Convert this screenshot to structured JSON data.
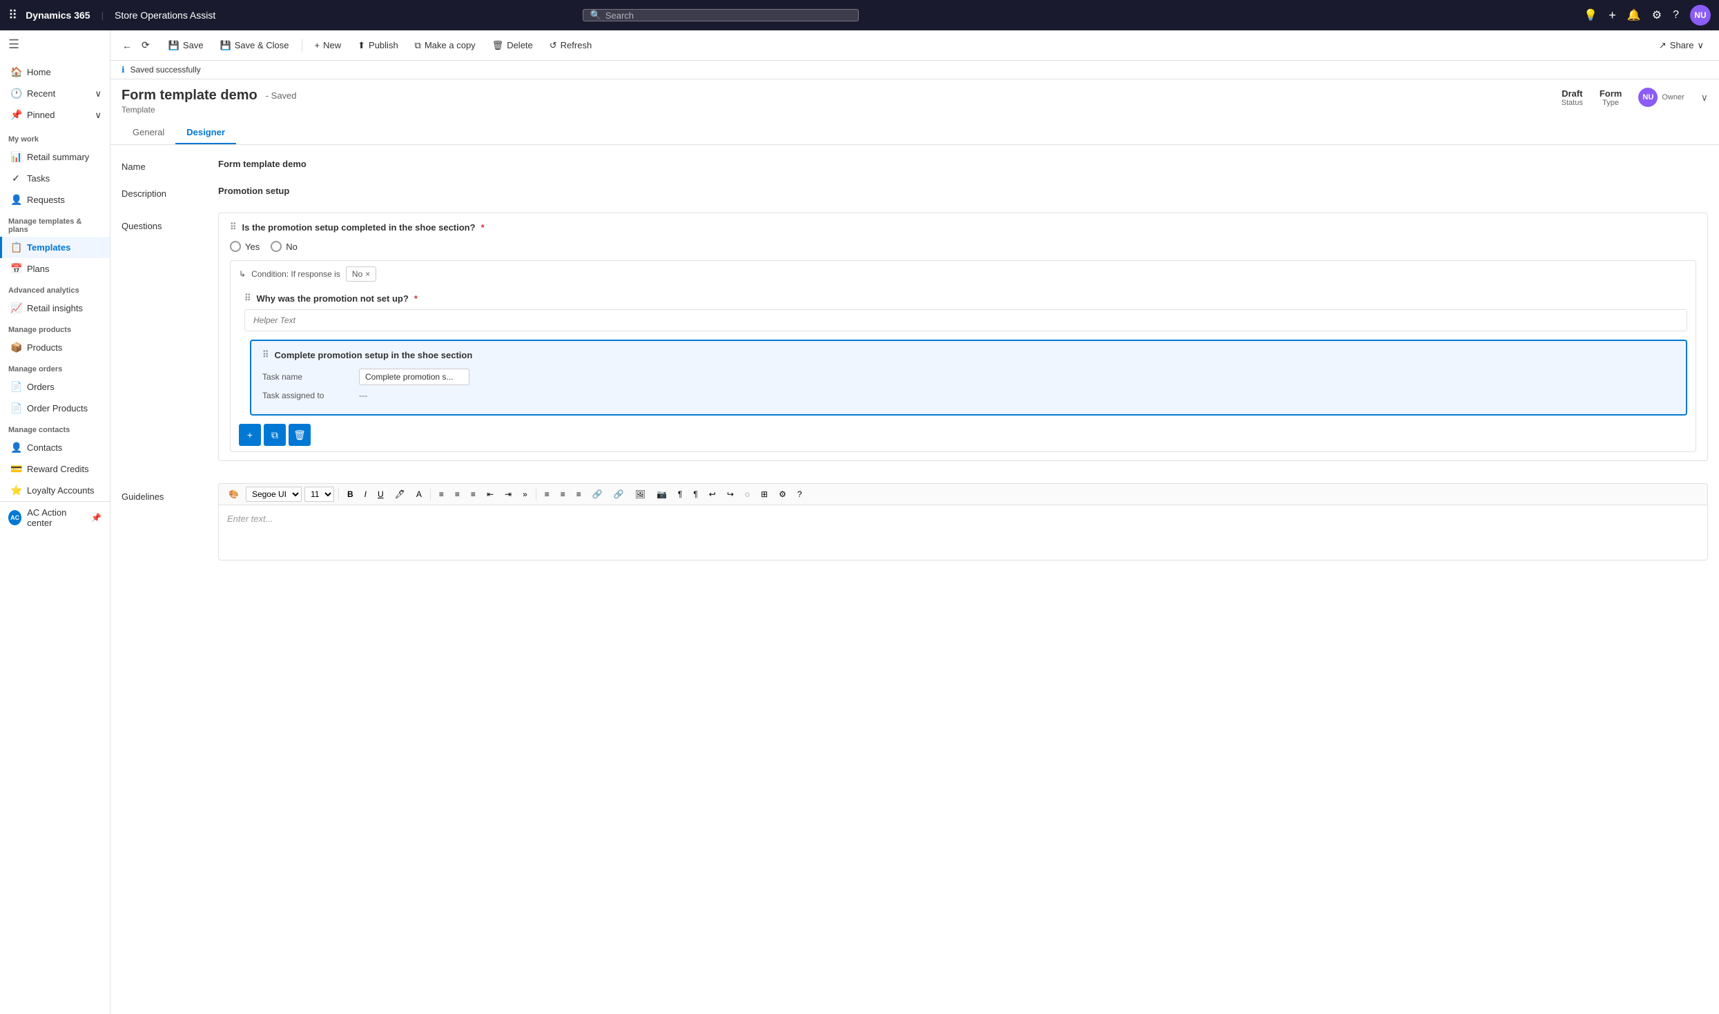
{
  "topNav": {
    "dotsIcon": "⠿",
    "logo": "Dynamics 365",
    "separator": "|",
    "appName": "Store Operations Assist",
    "searchPlaceholder": "Search",
    "icons": {
      "lightbulb": "💡",
      "plus": "+",
      "bell": "🔔",
      "gear": "⚙",
      "help": "?"
    },
    "avatar": "NU"
  },
  "toolbar": {
    "backLabel": "←",
    "forwardLabel": "⟳",
    "save": "Save",
    "saveClose": "Save & Close",
    "new": "New",
    "publish": "Publish",
    "makeCopy": "Make a copy",
    "delete": "Delete",
    "refresh": "Refresh",
    "share": "Share"
  },
  "savedNotice": {
    "icon": "ℹ",
    "text": "Saved successfully"
  },
  "formHeader": {
    "title": "Form template demo",
    "savedLabel": "- Saved",
    "subtitle": "Template",
    "statusLabel": "Status",
    "statusValue": "Draft",
    "typeLabel": "Type",
    "typeValue": "Form",
    "ownerLabel": "Owner",
    "ownerAvatar": "NU",
    "tabs": [
      "General",
      "Designer"
    ]
  },
  "formFields": {
    "nameLabel": "Name",
    "nameValue": "Form template demo",
    "descriptionLabel": "Description",
    "descriptionValue": "Promotion setup",
    "questionsLabel": "Questions"
  },
  "question1": {
    "text": "Is the promotion setup completed in the shoe section?",
    "required": "*",
    "options": [
      "Yes",
      "No"
    ],
    "conditionLabel": "Condition: If response is",
    "conditionValue": "No"
  },
  "question2": {
    "text": "Why was the promotion not set up?",
    "required": "*",
    "helperPlaceholder": "Helper Text"
  },
  "taskCard": {
    "title": "Complete promotion setup in the shoe section",
    "taskNameLabel": "Task name",
    "taskNameValue": "Complete promotion s...",
    "taskAssignedLabel": "Task assigned to",
    "taskAssignedValue": "---"
  },
  "actionButtons": {
    "add": "+",
    "copy": "⧉",
    "delete": "🗑"
  },
  "guidelines": {
    "label": "Guidelines",
    "fontFamily": "Segoe UI",
    "fontSize": "11",
    "placeholder": "Enter text...",
    "toolbar": [
      "🎨",
      "Segoe UI",
      "11",
      "B",
      "I",
      "U",
      "A",
      "A",
      "≡",
      "≡",
      "≡",
      "⇤",
      "⇥",
      "»",
      "≡",
      "≡",
      "≡",
      "🔗",
      "🔗",
      "⊞",
      "📷",
      "¶",
      "¶",
      "⟲",
      "⟳",
      "◌",
      "⊞",
      "⚙",
      "?"
    ]
  },
  "sidebar": {
    "toggleIcon": "☰",
    "items": [
      {
        "label": "Home",
        "icon": "🏠",
        "active": false
      },
      {
        "label": "Recent",
        "icon": "🕐",
        "hasArrow": true,
        "active": false
      },
      {
        "label": "Pinned",
        "icon": "📌",
        "hasArrow": true,
        "active": false
      }
    ],
    "myWork": {
      "label": "My work",
      "items": [
        {
          "label": "Retail summary",
          "icon": "📊",
          "active": false
        },
        {
          "label": "Tasks",
          "icon": "✓",
          "active": false
        },
        {
          "label": "Requests",
          "icon": "👤",
          "active": false
        }
      ]
    },
    "manageTemplates": {
      "label": "Manage templates & plans",
      "items": [
        {
          "label": "Templates",
          "icon": "📋",
          "active": true
        },
        {
          "label": "Plans",
          "icon": "📅",
          "active": false
        }
      ]
    },
    "advancedAnalytics": {
      "label": "Advanced analytics",
      "items": [
        {
          "label": "Retail insights",
          "icon": "📈",
          "active": false
        }
      ]
    },
    "manageProducts": {
      "label": "Manage products",
      "items": [
        {
          "label": "Products",
          "icon": "📦",
          "active": false
        }
      ]
    },
    "manageOrders": {
      "label": "Manage orders",
      "items": [
        {
          "label": "Orders",
          "icon": "📄",
          "active": false
        },
        {
          "label": "Order Products",
          "icon": "📄",
          "active": false
        }
      ]
    },
    "manageContacts": {
      "label": "Manage contacts",
      "items": [
        {
          "label": "Contacts",
          "icon": "👤",
          "active": false
        },
        {
          "label": "Reward Credits",
          "icon": "💳",
          "active": false
        },
        {
          "label": "Loyalty Accounts",
          "icon": "⭐",
          "active": false
        }
      ]
    },
    "actionCenter": {
      "label": "AC Action center",
      "icon": "AC",
      "pinIcon": "📌"
    }
  }
}
